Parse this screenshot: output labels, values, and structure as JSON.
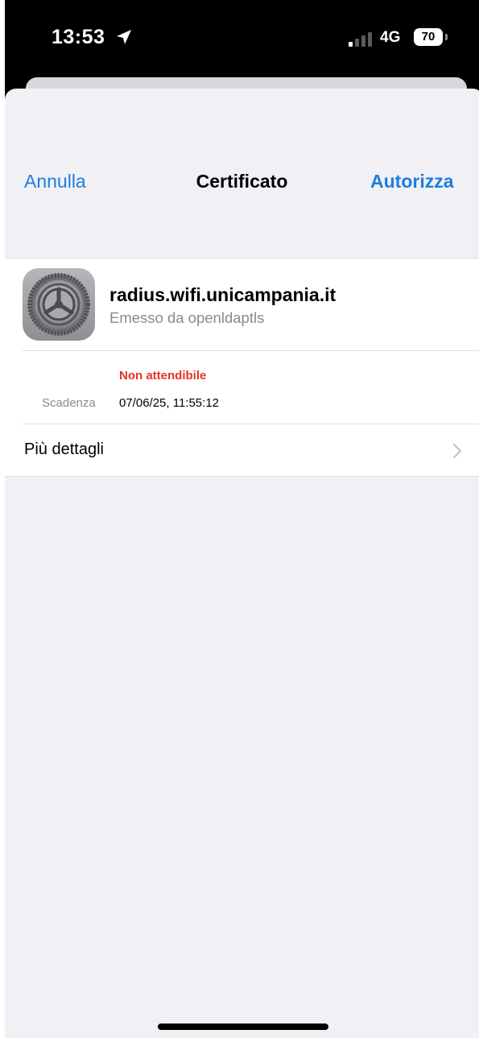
{
  "status_bar": {
    "time": "13:53",
    "network": "4G",
    "battery": "70",
    "icons": [
      "location-arrow-icon",
      "signal-icon",
      "battery-icon"
    ]
  },
  "nav": {
    "cancel_label": "Annulla",
    "title": "Certificato",
    "trust_label": "Autorizza"
  },
  "certificate": {
    "icon": "settings-gear-icon",
    "name": "radius.wifi.unicampania.it",
    "issuer": "Emesso da openldaptls",
    "trust_status": "Non attendibile",
    "expiry_label": "Scadenza",
    "expiry_value": "07/06/25, 11:55:12"
  },
  "details": {
    "label": "Più dettagli"
  },
  "colors": {
    "accent": "#1e7ce0",
    "warning": "#e5332a",
    "background": "#f0f0f5"
  }
}
